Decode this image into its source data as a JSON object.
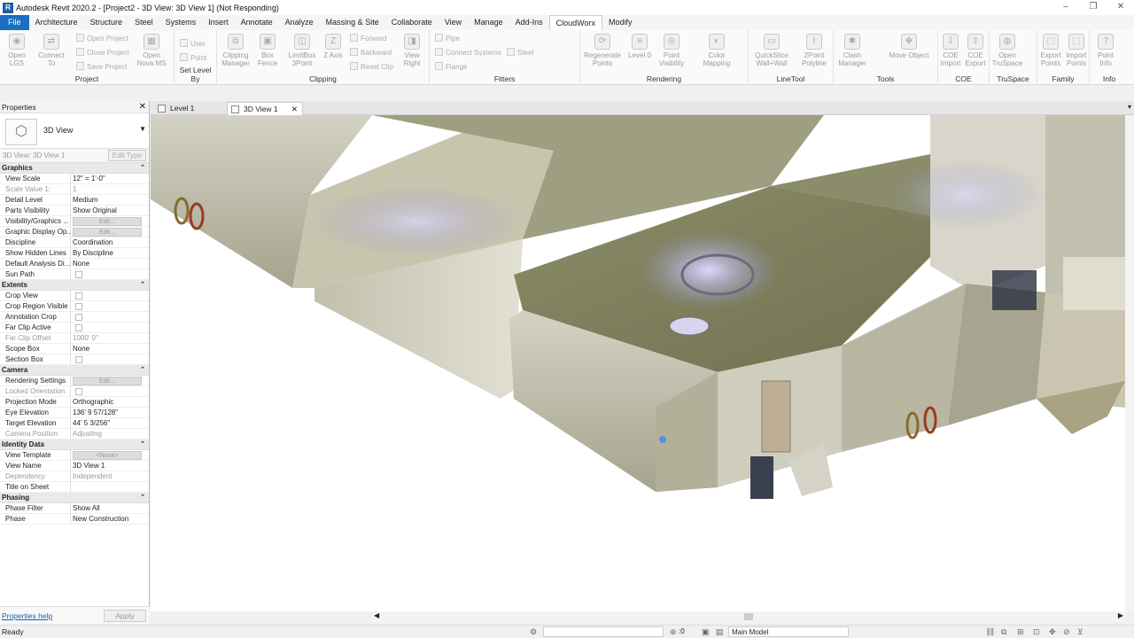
{
  "titlebar": {
    "logo": "R",
    "title": "Autodesk Revit 2020.2 - [Project2 - 3D View: 3D View 1] (Not Responding)",
    "minimize": "–",
    "maximize": "❐",
    "close": "✕"
  },
  "menu": [
    "File",
    "Architecture",
    "Structure",
    "Steel",
    "Systems",
    "Insert",
    "Annotate",
    "Analyze",
    "Massing & Site",
    "Collaborate",
    "View",
    "Manage",
    "Add-Ins",
    "CloudWorx",
    "Modify"
  ],
  "ribbon": {
    "panels": {
      "project": "Project",
      "setlevel": "Set Level By",
      "clipping": "Clipping",
      "fitters": "Fitters",
      "rendering": "Rendering",
      "linetool": "LineTool",
      "tools": "Tools",
      "coe": "COE",
      "truspace": "TruSpace",
      "family": "Family",
      "info": "Info"
    },
    "tools": {
      "open_lgs": "Open LGS",
      "connect_to": "Connect To",
      "open_nova": "Open Nova MS",
      "open_project": "Open Project",
      "close_project": "Close Project",
      "save_project": "Save Project",
      "user": "User",
      "point": "Point",
      "clipping_manager": "Clipping Manager",
      "box_fence": "Box Fence",
      "limitbox": "LimitBox 3Point",
      "z_axis": "Z Axis",
      "view_right": "View Right",
      "forward": "Forward",
      "backward": "Backward",
      "reset_clip": "Reset Clip",
      "pipe": "Pipe",
      "connect_systems": "Connect Systems",
      "steel": "Steel",
      "flange": "Flange",
      "regenerate_points": "Regenerate Points",
      "level0": "Level 0",
      "point_visibility": "Point Visibility",
      "color_mapping": "Color Mapping",
      "quickslice": "QuickSlice Wall+Wall",
      "polyline": "2Point Polyline",
      "clash_manager": "Clash Manager",
      "move_object": "Move Object",
      "coe_import": "COE Import",
      "coe_export": "COE Export",
      "open_truspace": "Open TruSpace",
      "export_points": "Export Points",
      "import_points": "Import Points",
      "point_info": "Point Info"
    }
  },
  "properties": {
    "header": "Properties",
    "close": "✕",
    "type_name": "3D View",
    "instance": "3D View: 3D View 1",
    "edit_type": "Edit Type",
    "sections": [
      {
        "title": "Graphics",
        "rows": [
          {
            "name": "View Scale",
            "value": "12\" = 1'-0\""
          },
          {
            "name": "Scale Value   1:",
            "value": "1",
            "dis": true
          },
          {
            "name": "Detail Level",
            "value": "Medium"
          },
          {
            "name": "Parts Visibility",
            "value": "Show Original"
          },
          {
            "name": "Visibility/Graphics ...",
            "value": "Edit...",
            "btn": true
          },
          {
            "name": "Graphic Display Op...",
            "value": "Edit...",
            "btn": true
          },
          {
            "name": "Discipline",
            "value": "Coordination"
          },
          {
            "name": "Show Hidden Lines",
            "value": "By Discipline"
          },
          {
            "name": "Default Analysis Di...",
            "value": "None"
          },
          {
            "name": "Sun Path",
            "value": "",
            "chk": true
          }
        ]
      },
      {
        "title": "Extents",
        "rows": [
          {
            "name": "Crop View",
            "value": "",
            "chk": true
          },
          {
            "name": "Crop Region Visible",
            "value": "",
            "chk": true
          },
          {
            "name": "Annotation Crop",
            "value": "",
            "chk": true
          },
          {
            "name": "Far Clip Active",
            "value": "",
            "chk": true
          },
          {
            "name": "Far Clip Offset",
            "value": "1000'  0\"",
            "dis": true
          },
          {
            "name": "Scope Box",
            "value": "None"
          },
          {
            "name": "Section Box",
            "value": "",
            "chk": true
          }
        ]
      },
      {
        "title": "Camera",
        "rows": [
          {
            "name": "Rendering Settings",
            "value": "Edit...",
            "btn": true
          },
          {
            "name": "Locked Orientation",
            "value": "",
            "chk": true,
            "dis": true
          },
          {
            "name": "Projection Mode",
            "value": "Orthographic"
          },
          {
            "name": "Eye Elevation",
            "value": "136'  9 57/128\""
          },
          {
            "name": "Target Elevation",
            "value": "44'  5 3/256\""
          },
          {
            "name": "Camera Position",
            "value": "Adjusting",
            "dis": true
          }
        ]
      },
      {
        "title": "Identity Data",
        "rows": [
          {
            "name": "View Template",
            "value": "<None>",
            "btn": true
          },
          {
            "name": "View Name",
            "value": "3D View 1"
          },
          {
            "name": "Dependency",
            "value": "Independent",
            "dis": true
          },
          {
            "name": "Title on Sheet",
            "value": ""
          }
        ]
      },
      {
        "title": "Phasing",
        "rows": [
          {
            "name": "Phase Filter",
            "value": "Show All"
          },
          {
            "name": "Phase",
            "value": "New Construction"
          }
        ]
      }
    ],
    "help": "Properties help",
    "apply": "Apply"
  },
  "tabs": [
    {
      "label": "Level 1"
    },
    {
      "label": "3D View 1",
      "active": true
    }
  ],
  "status": {
    "text": "Ready",
    "count": ":0",
    "model": "Main Model"
  },
  "colors": {
    "accent": "#1a6fc4",
    "concrete": "#a9a68c",
    "light": "#c9c4f0"
  }
}
